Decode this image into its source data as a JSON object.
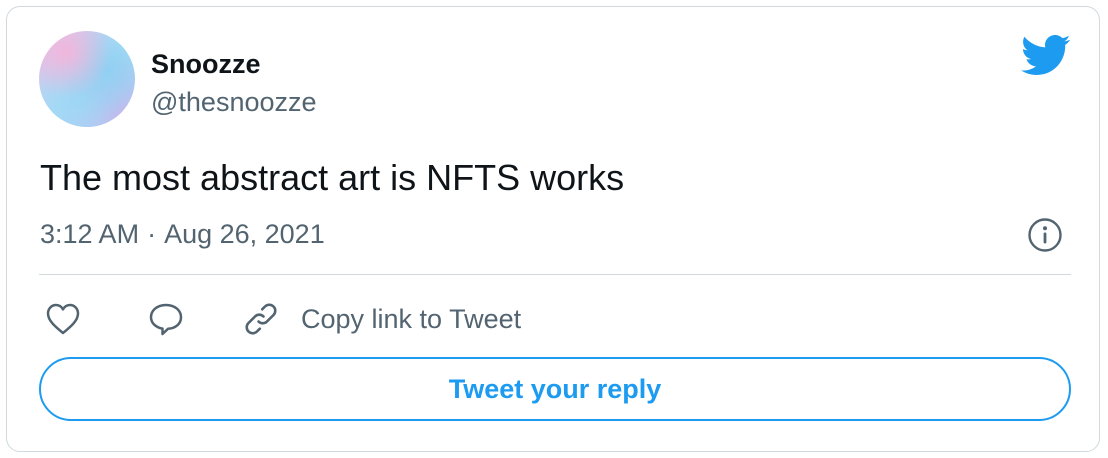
{
  "user": {
    "display_name": "Snoozze",
    "handle": "@thesnoozze",
    "avatar_icon": "avatar-image"
  },
  "tweet": {
    "text": "The most abstract art is NFTS works",
    "time": "3:12 AM",
    "separator": "·",
    "date": "Aug 26, 2021"
  },
  "actions": {
    "like_icon": "heart-icon",
    "reply_icon": "speech-bubble-icon",
    "copy_icon": "link-icon",
    "copy_label": "Copy link to Tweet",
    "info_icon": "info-icon",
    "brand_icon": "twitter-bird-icon"
  },
  "reply": {
    "label": "Tweet your reply"
  },
  "colors": {
    "brand": "#1d9bf0",
    "text_primary": "#0f1419",
    "text_secondary": "#536471",
    "border": "#cfd9de"
  }
}
